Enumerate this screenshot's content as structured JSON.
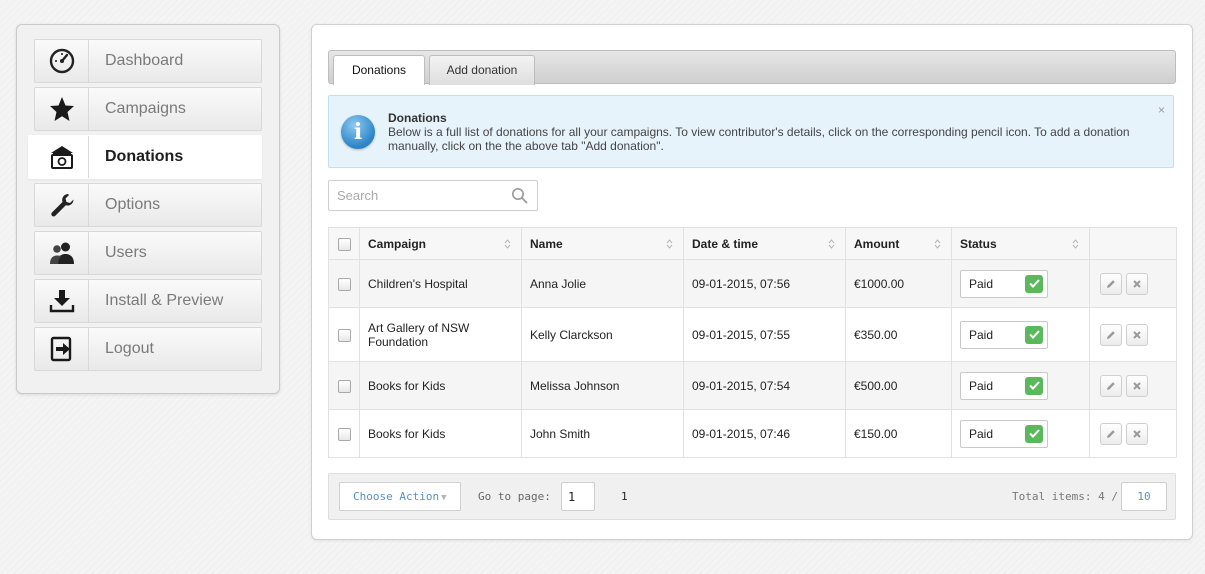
{
  "sidebar": {
    "items": [
      {
        "label": "Dashboard",
        "icon": "dashboard-icon"
      },
      {
        "label": "Campaigns",
        "icon": "star-icon"
      },
      {
        "label": "Donations",
        "icon": "donations-icon",
        "active": true
      },
      {
        "label": "Options",
        "icon": "wrench-icon"
      },
      {
        "label": "Users",
        "icon": "users-icon"
      },
      {
        "label": "Install & Preview",
        "icon": "download-icon"
      },
      {
        "label": "Logout",
        "icon": "logout-icon"
      }
    ]
  },
  "tabs": [
    {
      "label": "Donations",
      "active": true
    },
    {
      "label": "Add donation",
      "active": false
    }
  ],
  "info": {
    "title": "Donations",
    "text": "Below is a full list of donations for all your campaigns. To view contributor's details, click on the corresponding pencil icon. To add a donation manually, click on the the above tab \"Add donation\".",
    "close": "×"
  },
  "search": {
    "placeholder": "Search",
    "value": ""
  },
  "table": {
    "columns": [
      "Campaign",
      "Name",
      "Date & time",
      "Amount",
      "Status"
    ],
    "rows": [
      {
        "campaign": "Children's Hospital",
        "name": "Anna Jolie",
        "datetime": "09-01-2015, 07:56",
        "amount": "€1000.00",
        "status": "Paid"
      },
      {
        "campaign": "Art Gallery of NSW Foundation",
        "name": "Kelly Clarckson",
        "datetime": "09-01-2015, 07:55",
        "amount": "€350.00",
        "status": "Paid"
      },
      {
        "campaign": "Books for Kids",
        "name": "Melissa Johnson",
        "datetime": "09-01-2015, 07:54",
        "amount": "€500.00",
        "status": "Paid"
      },
      {
        "campaign": "Books for Kids",
        "name": "John Smith",
        "datetime": "09-01-2015, 07:46",
        "amount": "€150.00",
        "status": "Paid"
      }
    ]
  },
  "footer": {
    "choose_action": "Choose Action",
    "goto_label": "Go to page:",
    "goto_value": "1",
    "page_count": "1",
    "total_items": "Total items: 4 /",
    "per_page": "10"
  },
  "colors": {
    "accent_blue": "#5592c7",
    "status_green": "#5cb85c",
    "info_bg": "#e6f3fa"
  }
}
